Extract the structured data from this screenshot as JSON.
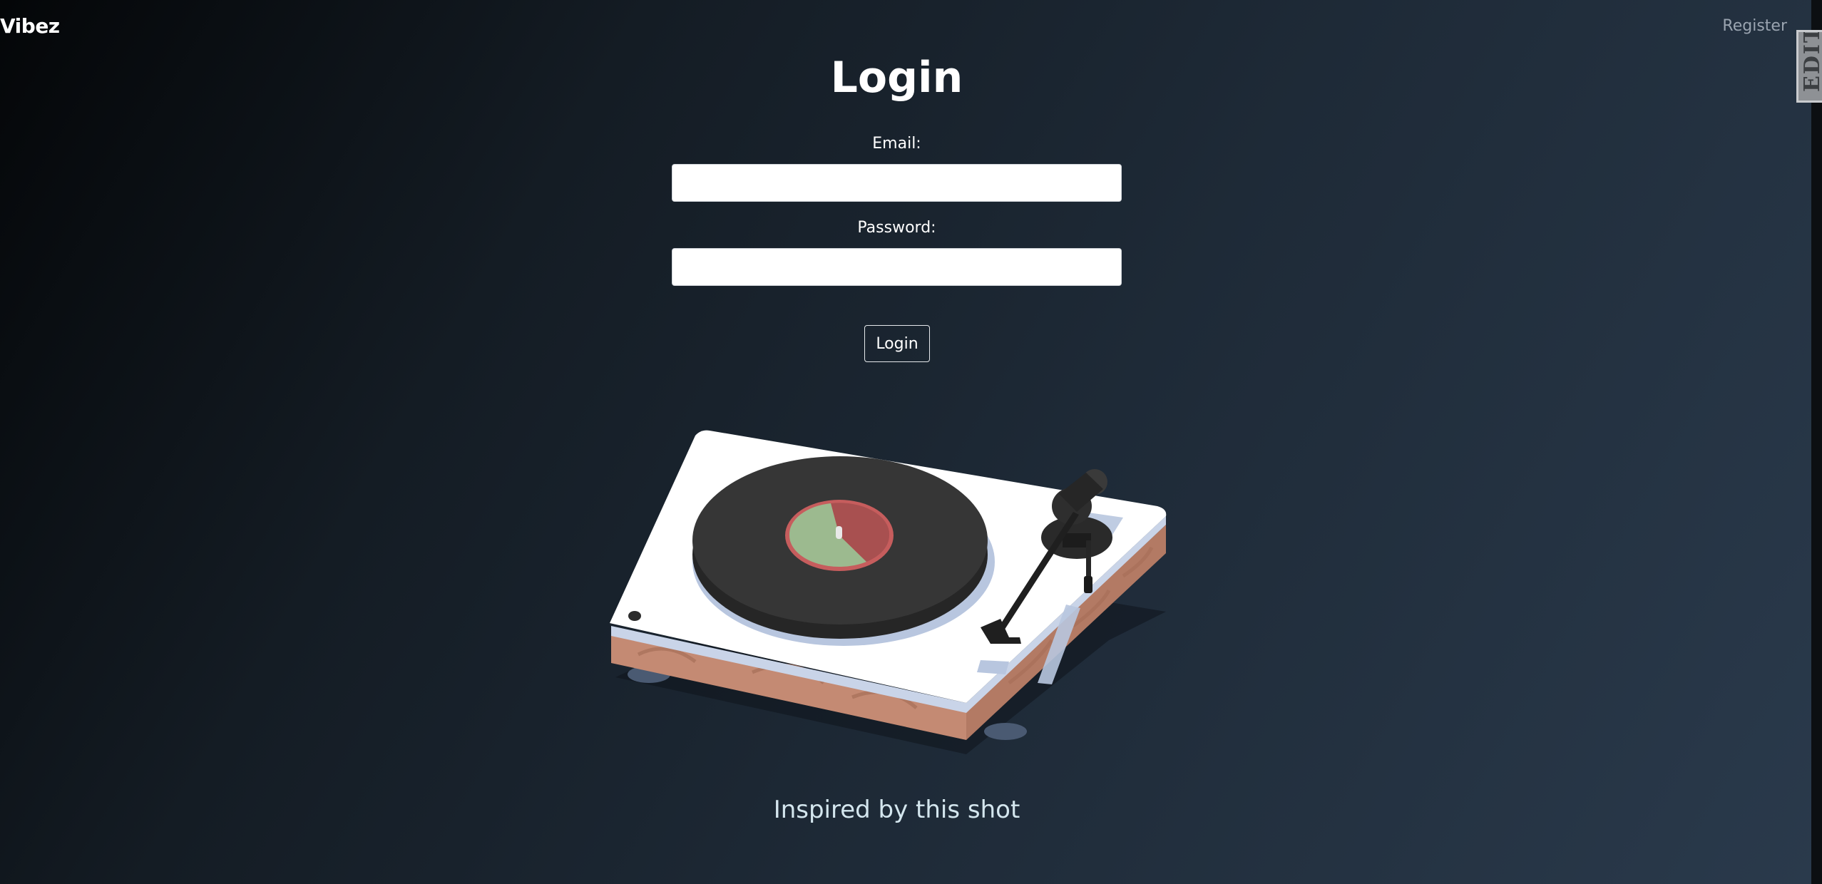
{
  "brand": {
    "name": "Vibez"
  },
  "nav": {
    "register_label": "Register"
  },
  "edit_tab": {
    "label": "EDIT"
  },
  "form": {
    "title": "Login",
    "email_label": "Email:",
    "email_value": "",
    "password_label": "Password:",
    "password_value": "",
    "submit_label": "Login"
  },
  "illustration": {
    "subject": "turntable-illustration",
    "colors": {
      "plinth_top": "#ffffff",
      "wood": "#c48a73",
      "record": "#363636",
      "label_red": "#a85050",
      "label_green": "#9cba8f",
      "tonearm": "#1f1f1f",
      "shadow_blue": "#b8c6df"
    }
  },
  "footer": {
    "credit_text": "Inspired by this shot"
  },
  "colors": {
    "background_start": "#040608",
    "background_end": "#2a3a4c",
    "text": "#ffffff",
    "muted_link": "#9aa4b0",
    "credit": "#d4e6ee"
  }
}
